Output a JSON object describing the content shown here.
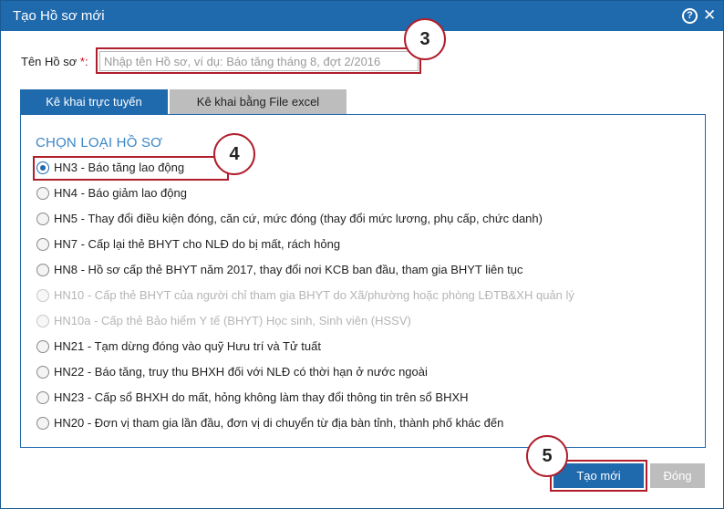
{
  "dialog": {
    "title": "Tạo Hồ sơ mới",
    "help_glyph": "?",
    "close_glyph": "✕"
  },
  "form": {
    "name_label": "Tên Hồ sơ",
    "required_mark": "*:",
    "name_placeholder": "Nhập tên Hồ sơ, ví dụ: Báo tăng tháng 8, đợt 2/2016",
    "name_value": ""
  },
  "tabs": [
    {
      "label": "Kê khai trực tuyến",
      "active": true
    },
    {
      "label": "Kê khai bằng File excel",
      "active": false
    }
  ],
  "section": {
    "title": "CHỌN LOẠI HỒ SƠ"
  },
  "options": [
    {
      "label": "HN3 - Báo tăng lao động",
      "selected": true,
      "disabled": false
    },
    {
      "label": "HN4 - Báo giảm lao động",
      "selected": false,
      "disabled": false
    },
    {
      "label": "HN5 - Thay đổi điều kiện đóng, căn cứ, mức đóng (thay đổi mức lương, phụ cấp, chức danh)",
      "selected": false,
      "disabled": false
    },
    {
      "label": "HN7 - Cấp lại thẻ BHYT cho NLĐ do bị mất, rách hỏng",
      "selected": false,
      "disabled": false
    },
    {
      "label": "HN8 - Hồ sơ cấp thẻ BHYT năm 2017, thay đổi nơi KCB ban đầu, tham gia BHYT liên tục",
      "selected": false,
      "disabled": false
    },
    {
      "label": "HN10 - Cấp thẻ BHYT của người chỉ tham gia BHYT do Xã/phường hoặc phòng LĐTB&XH quản lý",
      "selected": false,
      "disabled": true
    },
    {
      "label": "HN10a - Cấp thẻ Bảo hiểm Y tế (BHYT) Học sinh, Sinh viên (HSSV)",
      "selected": false,
      "disabled": true
    },
    {
      "label": "HN21 - Tạm dừng đóng vào quỹ Hưu trí và Tử tuất",
      "selected": false,
      "disabled": false
    },
    {
      "label": "HN22 - Báo tăng, truy thu BHXH đối với NLĐ có thời hạn ở nước ngoài",
      "selected": false,
      "disabled": false
    },
    {
      "label": "HN23 - Cấp sổ BHXH do mất, hỏng không làm thay đổi thông tin trên sổ BHXH",
      "selected": false,
      "disabled": false
    },
    {
      "label": "HN20 - Đơn vị tham gia lần đầu, đơn vị di chuyển từ địa bàn tỉnh, thành phố khác đến",
      "selected": false,
      "disabled": false
    }
  ],
  "buttons": {
    "create": "Tạo mới",
    "close": "Đóng"
  },
  "callouts": [
    "3",
    "4",
    "5"
  ],
  "colors": {
    "titlebar": "#1f69ad",
    "accent": "#1f69ad",
    "section_title": "#3a86c8",
    "highlight": "#b01e2c",
    "disabled_text": "#b5b5b5",
    "inactive": "#bdbdbd"
  }
}
